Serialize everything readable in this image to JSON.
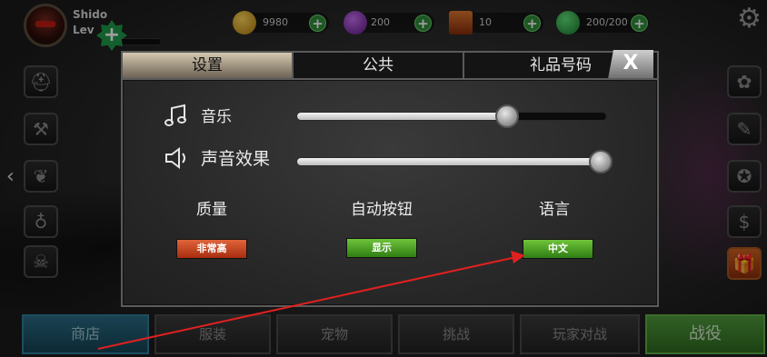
{
  "player": {
    "name": "Shido",
    "level_label": "Lev"
  },
  "resources": [
    {
      "name": "gold",
      "value": "9980"
    },
    {
      "name": "gems",
      "value": "200"
    },
    {
      "name": "tickets",
      "value": "10"
    },
    {
      "name": "energy",
      "value": "200/200"
    }
  ],
  "tabs": [
    {
      "label": "设置",
      "active": true
    },
    {
      "label": "公共",
      "active": false
    },
    {
      "label": "礼品号码",
      "active": false
    }
  ],
  "close_label": "X",
  "settings": {
    "music": {
      "label": "音乐",
      "level": 0.68
    },
    "sound": {
      "label": "声音效果",
      "level": 1.0
    },
    "quality": {
      "title": "质量",
      "value": "非常高"
    },
    "auto_button": {
      "title": "自动按钮",
      "value": "显示"
    },
    "language": {
      "title": "语言",
      "value": "中文"
    }
  },
  "bottom_nav": [
    "商店",
    "服装",
    "宠物",
    "挑战",
    "玩家对战",
    "战役"
  ],
  "colors": {
    "annotation_arrow": "#e02020",
    "accent_green": "#2f8f3a"
  }
}
